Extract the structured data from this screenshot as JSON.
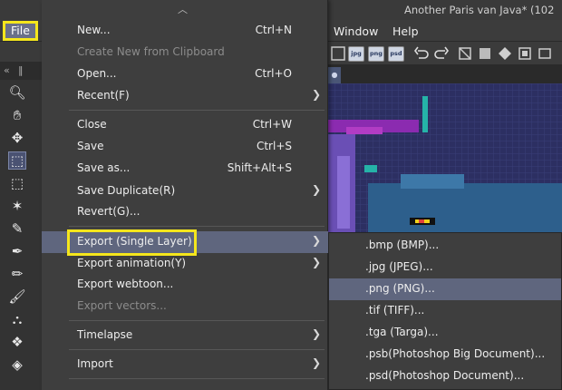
{
  "window": {
    "title": "Another Paris van Java* (102"
  },
  "menubar": {
    "file": "File",
    "window": "Window",
    "help": "Help"
  },
  "toolbar": {
    "formats": [
      "jpg",
      "png",
      "psd"
    ]
  },
  "file_menu": {
    "items": [
      {
        "label": "New...",
        "shortcut": "Ctrl+N"
      },
      {
        "label": "Create New from Clipboard",
        "shortcut": "",
        "disabled": true
      },
      {
        "label": "Open...",
        "shortcut": "Ctrl+O"
      },
      {
        "label": "Recent(F)",
        "shortcut": "",
        "submenu": true
      },
      {
        "label": "Close",
        "shortcut": "Ctrl+W"
      },
      {
        "label": "Save",
        "shortcut": "Ctrl+S"
      },
      {
        "label": "Save as...",
        "shortcut": "Shift+Alt+S"
      },
      {
        "label": "Save Duplicate(R)",
        "shortcut": "",
        "submenu": true
      },
      {
        "label": "Revert(G)...",
        "shortcut": ""
      },
      {
        "label": "Export (Single Layer)",
        "shortcut": "",
        "submenu": true,
        "active": true
      },
      {
        "label": "Export animation(Y)",
        "shortcut": "",
        "submenu": true
      },
      {
        "label": "Export webtoon...",
        "shortcut": ""
      },
      {
        "label": "Export vectors...",
        "shortcut": "",
        "disabled": true
      },
      {
        "label": "Timelapse",
        "shortcut": "",
        "submenu": true
      },
      {
        "label": "Import",
        "shortcut": "",
        "submenu": true
      }
    ]
  },
  "export_submenu": {
    "items": [
      {
        "label": ".bmp (BMP)..."
      },
      {
        "label": ".jpg (JPEG)..."
      },
      {
        "label": ".png (PNG)...",
        "active": true
      },
      {
        "label": ".tif (TIFF)..."
      },
      {
        "label": ".tga (Targa)..."
      },
      {
        "label": ".psb(Photoshop Big Document)..."
      },
      {
        "label": ".psd(Photoshop Document)..."
      }
    ]
  },
  "icons": {
    "tools": [
      "zoom-icon",
      "hand-icon",
      "move-icon",
      "object-select-icon",
      "selection-icon",
      "magic-wand-icon",
      "eyedropper-icon",
      "pen-icon",
      "pencil-icon",
      "brush-icon",
      "airbrush-icon",
      "decoration-icon",
      "eraser-icon"
    ],
    "toolbar": [
      "undo-icon",
      "redo-icon",
      "clear-icon",
      "fill-icon",
      "transform-icon"
    ]
  },
  "colors": {
    "highlight": "#f5e61c",
    "menu_active": "#5f667e",
    "menu_bg": "#3e3e3e"
  }
}
